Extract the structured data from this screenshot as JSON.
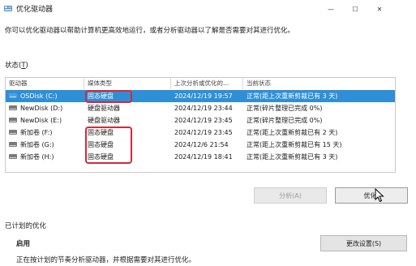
{
  "window": {
    "title": "优化驱动器",
    "minimize_glyph": "—",
    "maximize_glyph": "☐",
    "close_glyph": "✕"
  },
  "description": "你可以优化驱动器以帮助计算机更高效地运行，或者分析驱动器以了解是否需要对其进行优化。",
  "status_label": "状态",
  "status_hotkey": "T",
  "columns": [
    "驱动器",
    "媒体类型",
    "上次分析或优化的...",
    "当前状态"
  ],
  "drives": [
    {
      "name": "OSDisk (C:)",
      "media": "固态硬盘",
      "last": "2024/12/19 19:57",
      "state": "正常(距上次重新剪裁已有 3 天)",
      "icon": "windows-drive-icon",
      "selected": true,
      "highlight": true
    },
    {
      "name": "NewDisk (D:)",
      "media": "硬盘驱动器",
      "last": "2024/12/19 23:44",
      "state": "正常(碎片整理已完成 0%)",
      "icon": "hard-drive-icon",
      "selected": false,
      "highlight": false
    },
    {
      "name": "NewDisk (E:)",
      "media": "硬盘驱动器",
      "last": "2024/12/19 23:45",
      "state": "正常(碎片整理已完成 0%)",
      "icon": "hard-drive-icon",
      "selected": false,
      "highlight": false
    },
    {
      "name": "新加卷 (F:)",
      "media": "固态硬盘",
      "last": "2024/12/19 23:45",
      "state": "正常(距上次重新剪裁已有 2 天)",
      "icon": "hard-drive-icon",
      "selected": false,
      "highlight": true
    },
    {
      "name": "新加卷 (G:)",
      "media": "固态硬盘",
      "last": "2024/12/6 21:54",
      "state": "正常(距上次重新剪裁已有 15 天)",
      "icon": "hard-drive-icon",
      "selected": false,
      "highlight": true
    },
    {
      "name": "新加卷 (H:)",
      "media": "固态硬盘",
      "last": "2024/12/19 18:41",
      "state": "正常(距上次重新剪裁已有 3 天)",
      "icon": "hard-drive-icon",
      "selected": false,
      "highlight": true
    }
  ],
  "buttons": {
    "analyze": "分析(A)",
    "optimize": "优化(",
    "change_settings": "更改设置(S)"
  },
  "scheduled": {
    "label": "已计划的优化",
    "state": "启用",
    "description": "正在按计划的节奏分析驱动器，并根据需要对其进行优化。"
  },
  "colors": {
    "selection": "#2f8fd6",
    "annotation": "#d12a3b"
  }
}
